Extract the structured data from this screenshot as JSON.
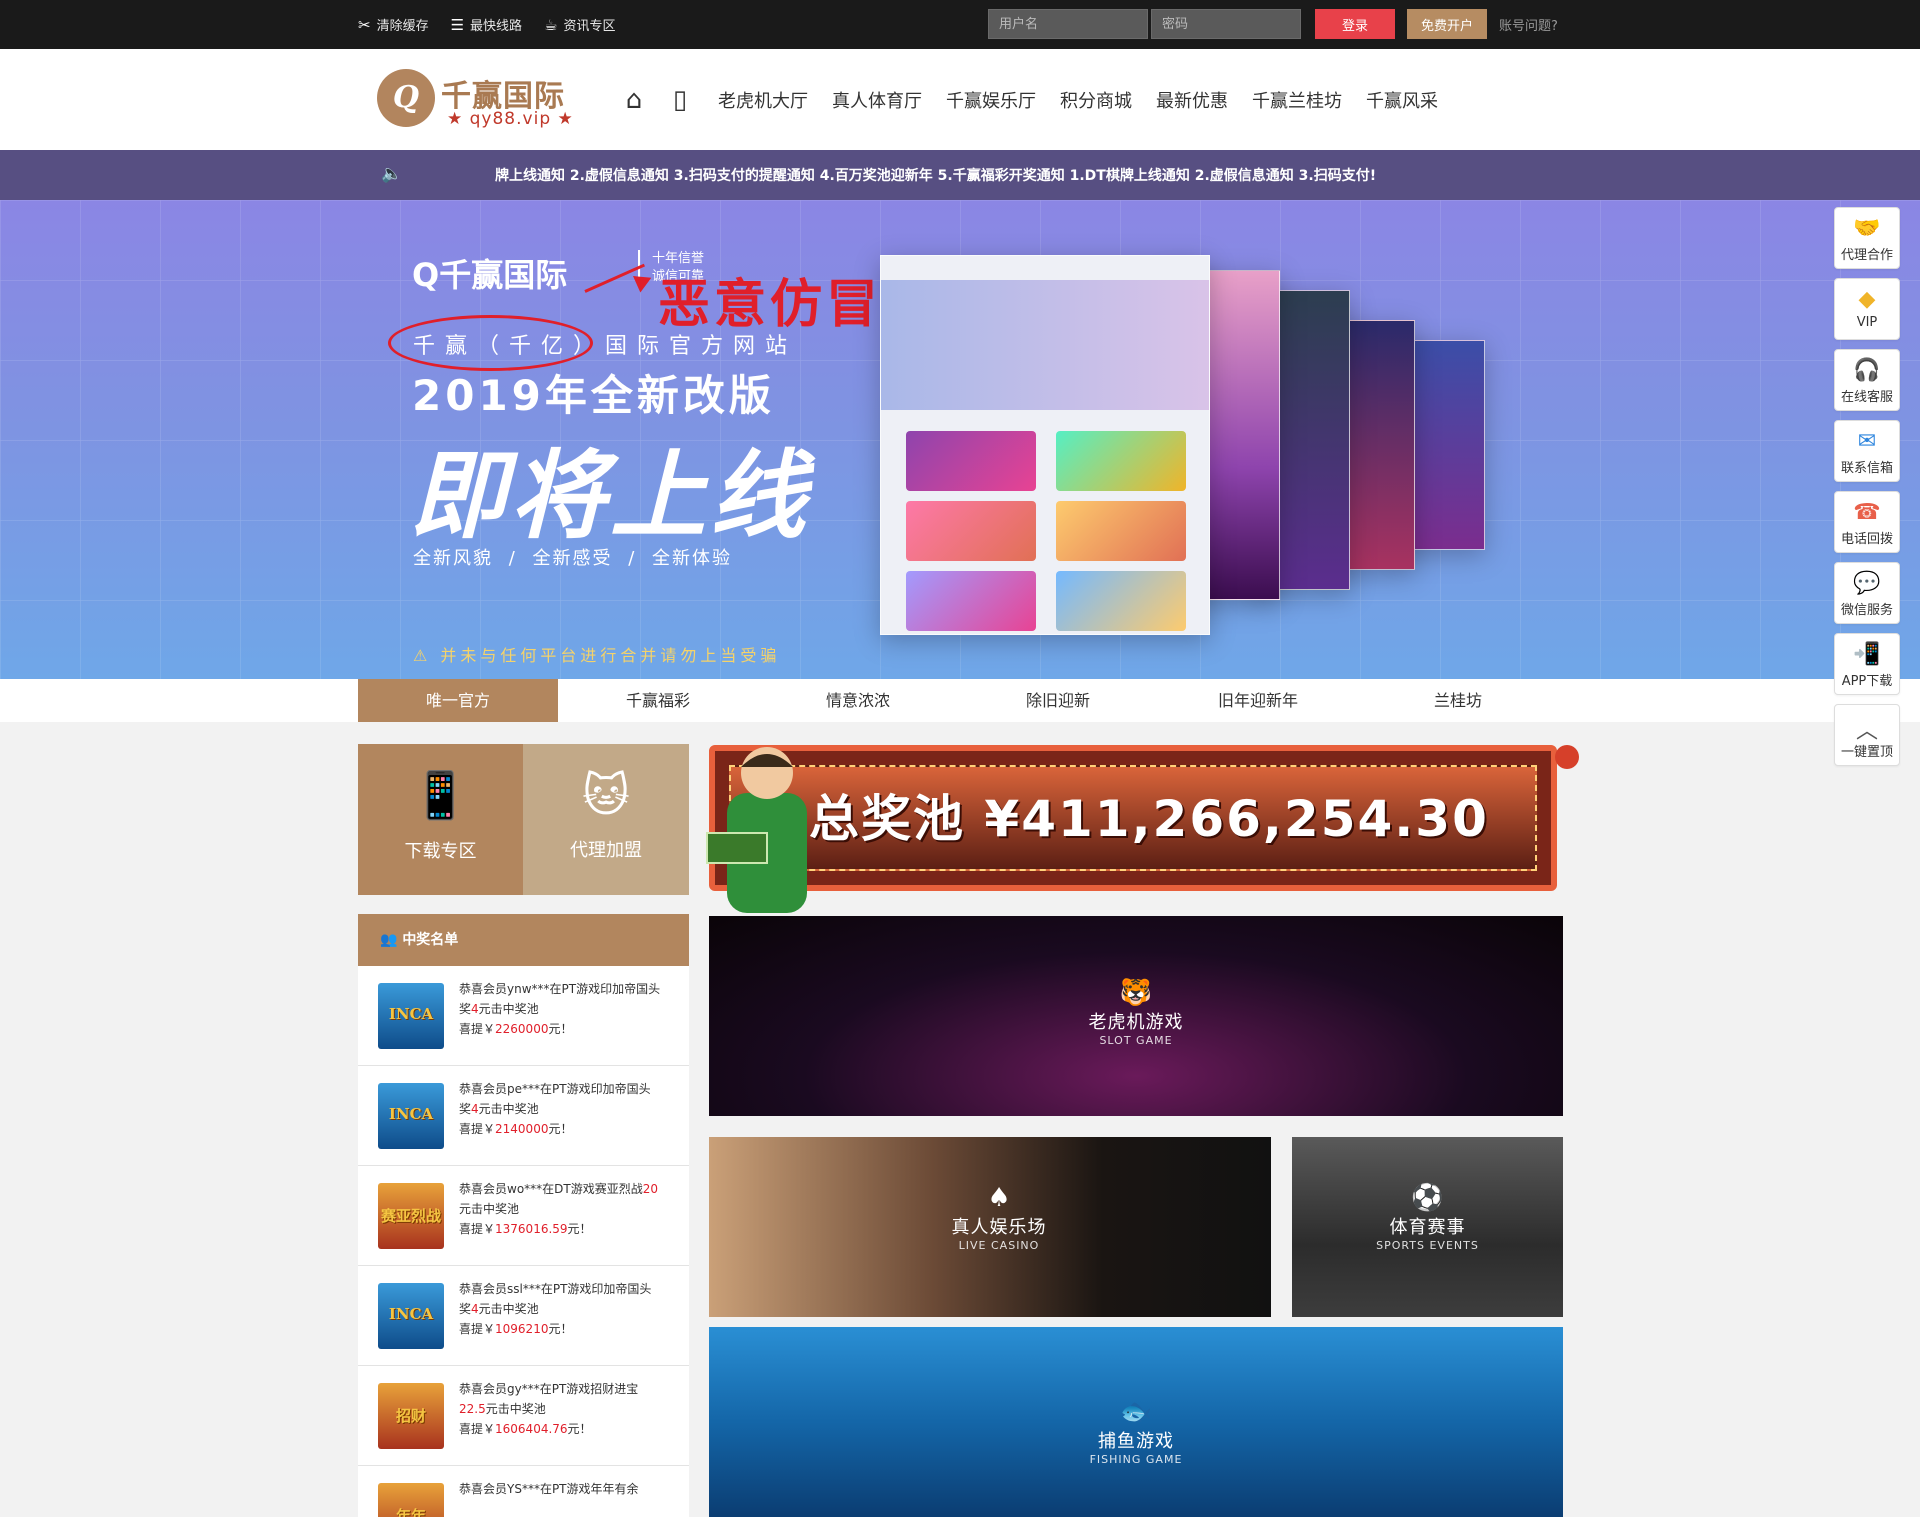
{
  "topbar": {
    "quick_links": [
      {
        "icon": "broom-icon",
        "glyph": "✂",
        "label": "清除缓存"
      },
      {
        "icon": "route-icon",
        "glyph": "☰",
        "label": "最快线路"
      },
      {
        "icon": "coffee-icon",
        "glyph": "☕",
        "label": "资讯专区"
      }
    ],
    "username_placeholder": "用户名",
    "password_placeholder": "密码",
    "login_label": "登录",
    "register_label": "免费开户",
    "forgot_label": "账号问题?"
  },
  "header": {
    "logo_mark": "Q",
    "logo_name": "千赢国际",
    "logo_url": "★ qy88.vip ★",
    "nav_icons": [
      {
        "icon": "home-icon",
        "glyph": "⌂"
      },
      {
        "icon": "mobile-icon",
        "glyph": "▯"
      }
    ],
    "nav_items": [
      "老虎机大厅",
      "真人体育厅",
      "千赢娱乐厅",
      "积分商城",
      "最新优惠",
      "千赢兰桂坊",
      "千赢风采"
    ]
  },
  "notice": {
    "speaker_glyph": "🔈",
    "text": "牌上线通知   2.虚假信息通知   3.扫码支付的提醒通知   4.百万奖池迎新年   5.千赢福彩开奖通知   1.DT棋牌上线通知   2.虚假信息通知   3.扫码支付!"
  },
  "banner": {
    "logo_text": "Q千赢国际",
    "slogan_line1": "十年信誉",
    "slogan_line2": "诚信可靠",
    "warning_red": "恶意仿冒宣传！！！",
    "subtitle": "千赢（千亿）国际官方网站",
    "year_line": "2019年全新改版",
    "big_text": "即将上线",
    "features": "全新风貌 / 全新感受 / 全新体验",
    "warning_bottom": "⚠ 并未与任何平台进行合并请勿上当受骗"
  },
  "subnav": {
    "tabs": [
      "唯一官方",
      "千赢福彩",
      "情意浓浓",
      "除旧迎新",
      "旧年迎新年",
      "兰桂坊"
    ]
  },
  "quick_buttons": [
    {
      "icon": "download-phone-icon",
      "glyph": "📱",
      "label": "下载专区",
      "color": "#b2865e"
    },
    {
      "icon": "lucky-cat-icon",
      "glyph": "🐱",
      "label": "代理加盟",
      "color": "#c2a988"
    }
  ],
  "winners": {
    "title": "中奖名单",
    "icon_glyph": "👥",
    "rows": [
      {
        "thumb": "INCA",
        "line1": "恭喜会员ynw***在PT游戏印加帝国头",
        "line2a": "奖",
        "line2red": "4",
        "line2b": "元击中奖池",
        "line3a": "喜提￥",
        "line3red": "2260000",
        "line3b": "元！"
      },
      {
        "thumb": "INCA",
        "line1": "恭喜会员pe***在PT游戏印加帝国头",
        "line2a": "奖",
        "line2red": "4",
        "line2b": "元击中奖池",
        "line3a": "喜提￥",
        "line3red": "2140000",
        "line3b": "元！"
      },
      {
        "thumb": "赛亚烈战",
        "line1": "恭喜会员wo***在DT游戏赛亚烈战",
        "line1red": "20",
        "line2a": "",
        "line2red": "",
        "line2b": "元击中奖池",
        "line3a": "喜提￥",
        "line3red": "1376016.59",
        "line3b": "元！"
      },
      {
        "thumb": "INCA",
        "line1": "恭喜会员ssl***在PT游戏印加帝国头",
        "line2a": "奖",
        "line2red": "4",
        "line2b": "元击中奖池",
        "line3a": "喜提￥",
        "line3red": "1096210",
        "line3b": "元！"
      },
      {
        "thumb": "招财",
        "line1": "恭喜会员gy***在PT游戏招财进宝",
        "line2a": "",
        "line2red": "22.5",
        "line2b": "元击中奖池",
        "line3a": "喜提￥",
        "line3red": "1606404.76",
        "line3b": "元！"
      },
      {
        "thumb": "年年",
        "line1": "恭喜会员YS***在PT游戏年年有余",
        "line2a": "",
        "line2red": "",
        "line2b": "",
        "line3a": "",
        "line3red": "",
        "line3b": ""
      }
    ]
  },
  "jackpot": {
    "label": "总奖池 ¥411,266,254.30"
  },
  "games": [
    {
      "icon": "tiger-icon",
      "glyph": "🐯",
      "cn": "老虎机游戏",
      "en": "SLOT GAME"
    },
    {
      "icon": "dealer-icon",
      "glyph": "♠",
      "cn": "真人娱乐场",
      "en": "LIVE CASINO"
    },
    {
      "icon": "soccer-icon",
      "glyph": "⚽",
      "cn": "体育赛事",
      "en": "SPORTS EVENTS"
    },
    {
      "icon": "fish-icon",
      "glyph": "🐟",
      "cn": "捕鱼游戏",
      "en": "FISHING GAME"
    }
  ],
  "side_buttons": [
    {
      "icon": "handshake-icon",
      "glyph": "🤝",
      "label": "代理合作",
      "color": "#2e86de"
    },
    {
      "icon": "vip-diamond-icon",
      "glyph": "◆",
      "label": "VIP",
      "color": "#f0b429"
    },
    {
      "icon": "headset-icon",
      "glyph": "🎧",
      "label": "在线客服",
      "color": "#e84545"
    },
    {
      "icon": "envelope-icon",
      "glyph": "✉",
      "label": "联系信箱",
      "color": "#2e86de"
    },
    {
      "icon": "phone-icon",
      "glyph": "☎",
      "label": "电话回拨",
      "color": "#e8604a"
    },
    {
      "icon": "wechat-icon",
      "glyph": "💬",
      "label": "微信服务",
      "color": "#3cb043"
    },
    {
      "icon": "app-download-icon",
      "glyph": "📲",
      "label": "APP下载",
      "color": "#2e86de"
    },
    {
      "icon": "back-to-top-icon",
      "glyph": "︿",
      "label": "一键置顶",
      "color": "#555555"
    }
  ]
}
